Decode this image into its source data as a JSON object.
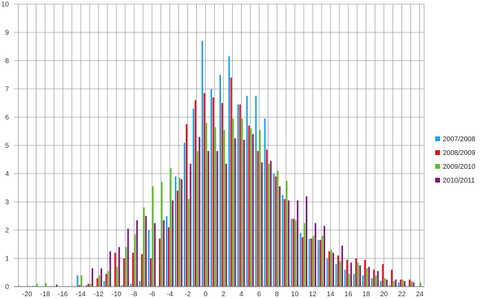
{
  "chart_data": {
    "type": "bar",
    "title": "",
    "xlabel": "",
    "ylabel": "",
    "ylim": [
      0,
      10
    ],
    "y_ticks": [
      0,
      1,
      2,
      3,
      4,
      5,
      6,
      7,
      8,
      9,
      10
    ],
    "x_tick_labels": [
      "-20",
      "-18",
      "-16",
      "-14",
      "-12",
      "-10",
      "-8",
      "-6",
      "-4",
      "-2",
      "0",
      "2",
      "4",
      "6",
      "8",
      "10",
      "12",
      "14",
      "16",
      "18",
      "20",
      "22",
      "24"
    ],
    "categories": [
      -21,
      -20,
      -19,
      -18,
      -17,
      -16,
      -15,
      -14,
      -13,
      -12,
      -11,
      -10,
      -9,
      -8,
      -7,
      -6,
      -5,
      -4,
      -3,
      -2,
      -1,
      0,
      1,
      2,
      3,
      4,
      5,
      6,
      7,
      8,
      9,
      10,
      11,
      12,
      13,
      14,
      15,
      16,
      17,
      18,
      19,
      20,
      21,
      22,
      23,
      24
    ],
    "grid": true,
    "legend_position": "right",
    "series": [
      {
        "name": "2007/2008",
        "color": "#21a4e0",
        "values": [
          0,
          0,
          0.03,
          0,
          0,
          0,
          0,
          0.4,
          0.05,
          0,
          0.2,
          0,
          0.05,
          0.1,
          0.2,
          2.0,
          0,
          2.5,
          3.9,
          5.1,
          6.3,
          8.7,
          7.0,
          7.5,
          8.15,
          6.45,
          6.75,
          6.75,
          5.95,
          4.0,
          3.25,
          2.4,
          1.9,
          1.7,
          1.65,
          1.0,
          0.8,
          0.6,
          0.45,
          0.4,
          0.3,
          0.2,
          0.05,
          0.15,
          0,
          0
        ]
      },
      {
        "name": "2008/2009",
        "color": "#e0121b",
        "values": [
          0,
          0,
          0,
          0,
          0,
          0,
          0,
          0.05,
          0.1,
          0.3,
          0.45,
          1.2,
          1.0,
          1.2,
          1.15,
          1.0,
          1.7,
          2.1,
          3.4,
          5.75,
          6.6,
          6.85,
          6.7,
          6.5,
          7.4,
          6.45,
          5.7,
          4.8,
          4.85,
          3.9,
          3.1,
          2.4,
          1.75,
          1.7,
          1.65,
          1.25,
          1.1,
          0.95,
          1.0,
          0.95,
          0.6,
          0.8,
          0.6,
          0.25,
          0.25,
          0
        ]
      },
      {
        "name": "2009/2010",
        "color": "#5cbf2a",
        "values": [
          0.03,
          0.03,
          0.1,
          0.13,
          0,
          0,
          0,
          0.4,
          0.1,
          0.4,
          0.55,
          0.7,
          1.4,
          1.85,
          2.8,
          3.55,
          3.7,
          4.2,
          3.85,
          3.1,
          4.8,
          5.8,
          5.65,
          5.55,
          5.95,
          5.95,
          5.6,
          5.55,
          4.35,
          4.1,
          3.75,
          2.35,
          2.25,
          1.8,
          1.8,
          1.3,
          0.9,
          0.45,
          0.85,
          0.65,
          0.4,
          0.3,
          0.2,
          0.25,
          0.2,
          0.15
        ]
      },
      {
        "name": "2010/2011",
        "color": "#7b1a7b",
        "values": [
          0,
          0,
          0,
          0,
          0.07,
          0,
          0,
          0,
          0.65,
          0.65,
          1.25,
          1.4,
          2.05,
          2.35,
          2.5,
          2.25,
          2.35,
          3.05,
          3.8,
          4.35,
          5.3,
          4.8,
          4.8,
          4.35,
          5.25,
          5.2,
          5.4,
          4.4,
          4.45,
          3.55,
          3.05,
          3.05,
          3.2,
          2.25,
          2.15,
          1.2,
          1.45,
          0.85,
          0.75,
          0.7,
          0.55,
          0.25,
          0.25,
          0.2,
          0.15,
          0
        ]
      }
    ]
  }
}
